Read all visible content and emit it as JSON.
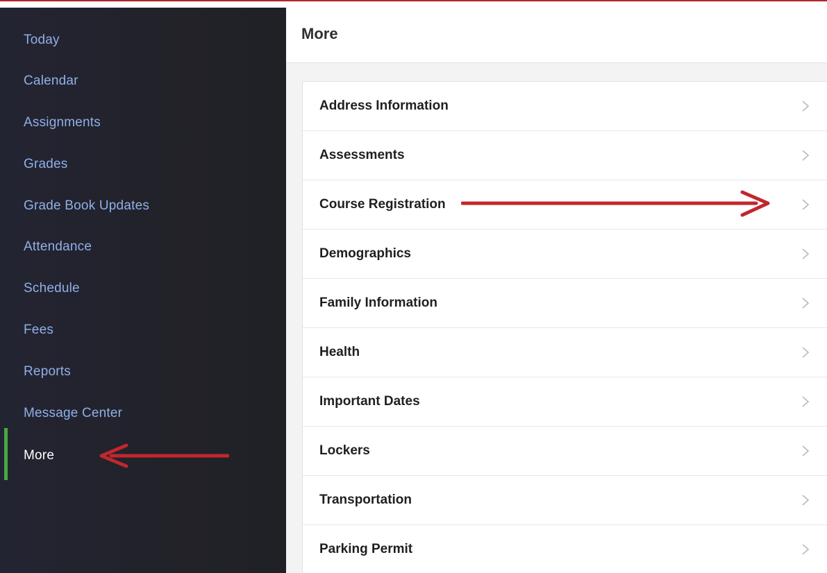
{
  "sidebar": {
    "items": [
      {
        "label": "Today",
        "active": false
      },
      {
        "label": "Calendar",
        "active": false
      },
      {
        "label": "Assignments",
        "active": false
      },
      {
        "label": "Grades",
        "active": false
      },
      {
        "label": "Grade Book Updates",
        "active": false
      },
      {
        "label": "Attendance",
        "active": false
      },
      {
        "label": "Schedule",
        "active": false
      },
      {
        "label": "Fees",
        "active": false
      },
      {
        "label": "Reports",
        "active": false
      },
      {
        "label": "Message Center",
        "active": false
      },
      {
        "label": "More",
        "active": true
      }
    ]
  },
  "main": {
    "title": "More",
    "items": [
      {
        "label": "Address Information"
      },
      {
        "label": "Assessments"
      },
      {
        "label": "Course Registration"
      },
      {
        "label": "Demographics"
      },
      {
        "label": "Family Information"
      },
      {
        "label": "Health"
      },
      {
        "label": "Important Dates"
      },
      {
        "label": "Lockers"
      },
      {
        "label": "Transportation"
      },
      {
        "label": "Parking Permit"
      }
    ]
  },
  "annotations": {
    "arrow_color": "#c1272d",
    "arrows": [
      "pointing-to-more",
      "pointing-to-course-registration"
    ]
  },
  "colors": {
    "sidebar_bg": "#222229",
    "sidebar_text": "#8fb0e8",
    "active_marker": "#4aa843",
    "accent_red": "#b1252c",
    "main_bg": "#f3f3f3"
  }
}
